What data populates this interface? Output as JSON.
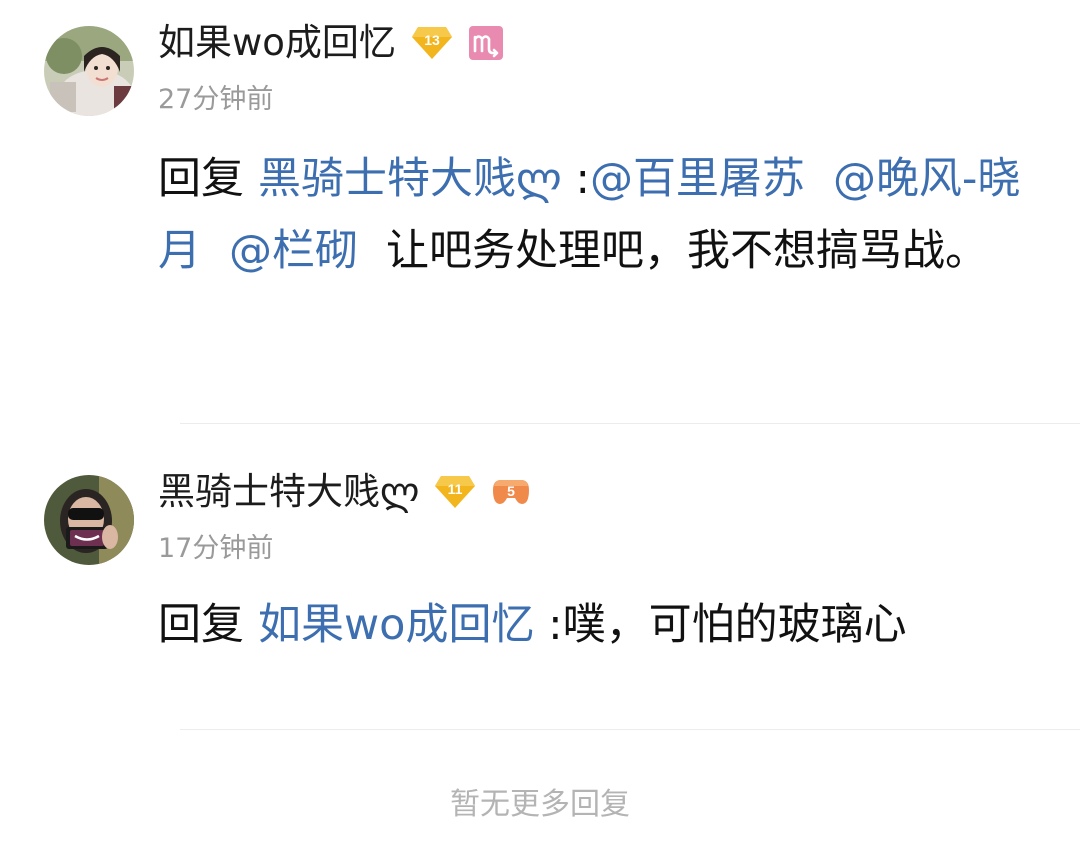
{
  "replies": [
    {
      "username": "如果wo成回忆",
      "level": "13",
      "time": "27分钟前",
      "reply_prefix": "回复",
      "reply_to": "黑骑士特大贱ლ",
      "colon": " :",
      "mentions": [
        "@百里屠苏",
        "@晚风-晓月",
        "@栏砌"
      ],
      "text": "让吧务处理吧，我不想搞骂战。",
      "level_badge_color": "#f2b51d",
      "extra_badge": "scorpio-icon",
      "extra_badge_color": "#e98bb1"
    },
    {
      "username": "黑骑士特大贱ლ",
      "level": "11",
      "time": "17分钟前",
      "reply_prefix": "回复",
      "reply_to": "如果wo成回忆",
      "colon": " :",
      "text": "噗，可怕的玻璃心",
      "level_badge_color": "#f2b51d",
      "extra_badge": "gamepad-level-icon",
      "extra_badge_value": "5",
      "extra_badge_color": "#f08a4b"
    }
  ],
  "footer": {
    "no_more_label": "暂无更多回复"
  },
  "colors": {
    "link": "#3d6fb0",
    "muted": "#9a9a9a",
    "divider": "#ececec"
  }
}
